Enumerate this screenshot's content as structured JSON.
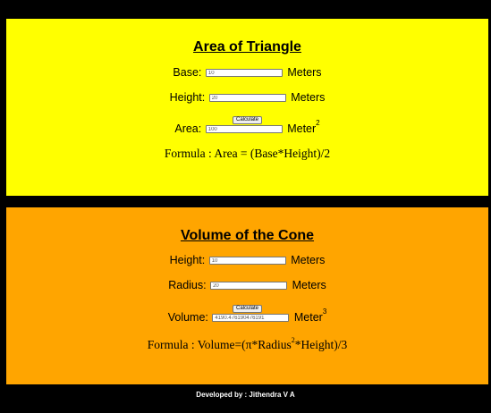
{
  "triangle": {
    "title": "Area of Triangle",
    "base_label": "Base:",
    "base_value": "10",
    "base_unit": "Meters",
    "height_label": "Height:",
    "height_value": "20",
    "height_unit": "Meters",
    "calculate_label": "Calculate",
    "area_label": "Area:",
    "area_value": "100",
    "area_unit": "Meter",
    "area_unit_exponent": "2",
    "formula_prefix": "Formula : Area = (Base*Height)/",
    "formula_divisor": "2",
    "bg_color": "#ffff00"
  },
  "cone": {
    "title": "Volume of the Cone",
    "height_label": "Height:",
    "height_value": "10",
    "height_unit": "Meters",
    "radius_label": "Radius:",
    "radius_value": "20",
    "radius_unit": "Meters",
    "calculate_label": "Calculate",
    "volume_label": "Volume:",
    "volume_value": "4190.476190476191",
    "volume_unit": "Meter",
    "volume_unit_exponent": "3",
    "formula_prefix": "Formula : Volume=(π*Radius",
    "formula_exponent": "2",
    "formula_suffix": "*Height)/",
    "formula_divisor": "3",
    "bg_color": "#ffa500"
  },
  "footer": {
    "text": "Developed by : Jithendra V A"
  }
}
